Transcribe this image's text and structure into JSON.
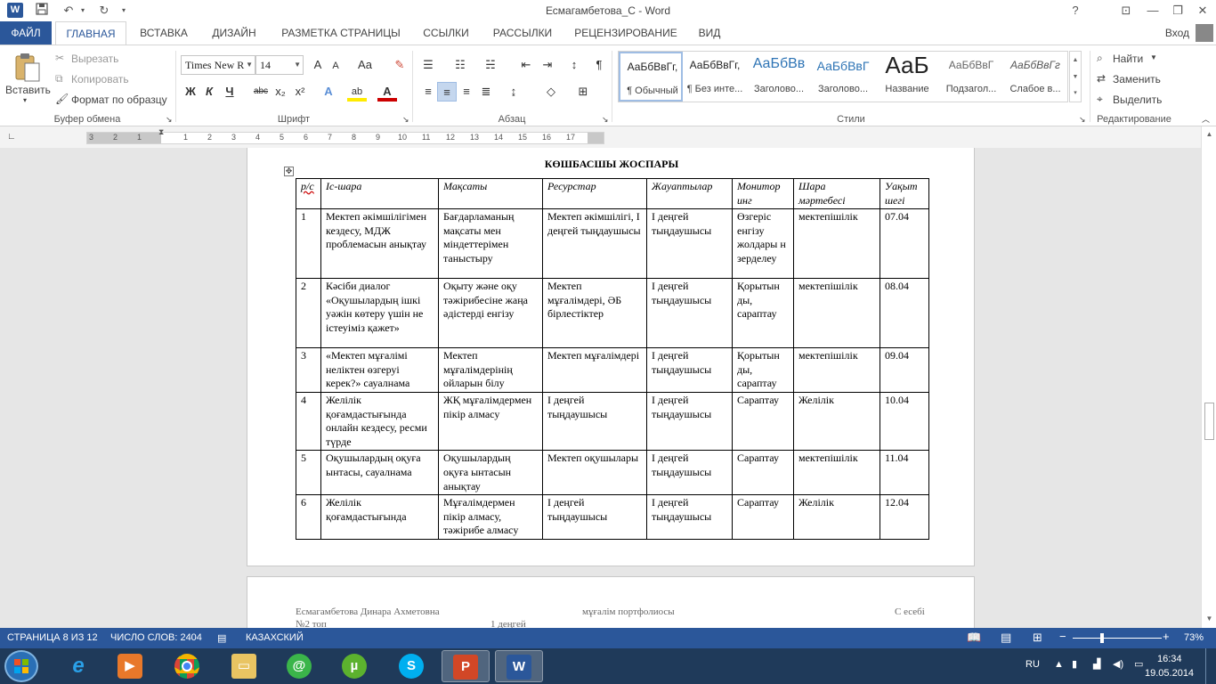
{
  "window": {
    "title": "Есмагамбетова_С - Word",
    "controls": {
      "help": "?",
      "restore_ribbon": "⊡",
      "minimize": "—",
      "maximize": "❐",
      "close": "✕"
    }
  },
  "quick_access": {
    "app_icon": "word-icon",
    "save": "save-icon",
    "undo": "undo-icon",
    "redo": "redo-icon",
    "customize": "dropdown-icon"
  },
  "tabs": [
    {
      "label": "ФАЙЛ"
    },
    {
      "label": "ГЛАВНАЯ"
    },
    {
      "label": "ВСТАВКА"
    },
    {
      "label": "ДИЗАЙН"
    },
    {
      "label": "РАЗМЕТКА СТРАНИЦЫ"
    },
    {
      "label": "ССЫЛКИ"
    },
    {
      "label": "РАССЫЛКИ"
    },
    {
      "label": "РЕЦЕНЗИРОВАНИЕ"
    },
    {
      "label": "ВИД"
    }
  ],
  "signin": "Вход",
  "clipboard": {
    "paste": "Вставить",
    "cut": "Вырезать",
    "copy": "Копировать",
    "format_painter": "Формат по образцу",
    "group": "Буфер обмена"
  },
  "font": {
    "name": "Times New R",
    "size": "14",
    "grow": "A",
    "shrink": "A",
    "case": "Aa",
    "bold": "Ж",
    "italic": "К",
    "underline": "Ч",
    "strike": "abc",
    "sub": "x₂",
    "sup": "x²",
    "effects": "A",
    "highlight": "ab",
    "color": "A",
    "group": "Шрифт"
  },
  "paragraph": {
    "group": "Абзац",
    "pilcrow": "¶"
  },
  "styles": {
    "items": [
      {
        "sample": "АаБбВвГг,",
        "name": "¶ Обычный"
      },
      {
        "sample": "АаБбВвГг,",
        "name": "¶ Без инте..."
      },
      {
        "sample": "АаБбВв",
        "name": "Заголово..."
      },
      {
        "sample": "АаБбВвГ",
        "name": "Заголово..."
      },
      {
        "sample": "АаБ",
        "name": "Название"
      },
      {
        "sample": "АаБбВвГ",
        "name": "Подзагол..."
      },
      {
        "sample": "АаБбВвГг",
        "name": "Слабое в..."
      }
    ],
    "group": "Стили"
  },
  "editing": {
    "find": "Найти",
    "replace": "Заменить",
    "select": "Выделить",
    "group": "Редактирование"
  },
  "ruler": {
    "numbers": [
      "3",
      "2",
      "1",
      "1",
      "2",
      "3",
      "4",
      "5",
      "6",
      "7",
      "8",
      "9",
      "10",
      "11",
      "12",
      "13",
      "14",
      "15",
      "16",
      "17"
    ]
  },
  "document": {
    "heading": "КӨШБАСШЫ ЖОСПАРЫ",
    "table": {
      "headers": [
        "р/с",
        "Іс-шара",
        "Мақсаты",
        "Ресурстар",
        "Жауаптылар",
        "Монитор инг",
        "Шара мәртебесі",
        "Уақыт шегі"
      ],
      "rows": [
        [
          "1",
          "Мектеп әкімшілігімен кездесу, МДЖ проблемасын анықтау",
          "Бағдарламаның мақсаты мен міндеттерімен таныстыру",
          "Мектеп әкімшілігі, І деңгей тыңдаушысы",
          "І деңгей тыңдаушысы",
          "Өзгеріс енгізу жолдары н зерделеу",
          "мектепішілік",
          "07.04"
        ],
        [
          "2",
          "Кәсіби диалог «Оқушылардың ішкі уәжін көтеру үшін не істеуіміз қажет»",
          "Оқыту және оқу тәжірибесіне жаңа әдістерді енгізу",
          "Мектеп мұғалімдері, ӘБ бірлестіктер",
          "І деңгей тыңдаушысы",
          "Қорытын ды, сараптау",
          "мектепішілік",
          "08.04"
        ],
        [
          "3",
          "«Мектеп мұғалімі неліктен өзгеруі керек?» сауалнама",
          "Мектеп мұғалімдерінің ойларын білу",
          "Мектеп мұғалімдері",
          "І деңгей тыңдаушысы",
          "Қорытын ды, сараптау",
          "мектепішілік",
          "09.04"
        ],
        [
          "4",
          "Желілік қоғамдастығында онлайн кездесу, ресми түрде",
          "ЖҚ мұғалімдермен пікір алмасу",
          "І деңгей тыңдаушысы",
          "І деңгей тыңдаушысы",
          "Сараптау",
          "Желілік",
          "10.04"
        ],
        [
          "5",
          "Оқушылардың оқуға ынтасы, сауалнама",
          "Оқушылардың оқуға ынтасын анықтау",
          "Мектеп оқушылары",
          "І деңгей тыңдаушысы",
          "Сараптау",
          "мектепішілік",
          "11.04"
        ],
        [
          "6",
          "Желілік қоғамдастығында",
          "Мұғалімдермен пікір алмасу, тәжірибе алмасу",
          "І деңгей тыңдаушысы",
          "І деңгей тыңдаушысы",
          "Сараптау",
          "Желілік",
          "12.04"
        ]
      ]
    },
    "footer": {
      "author": "Есмагамбетова Динара Ахметовна",
      "portfolio": "мұғалім портфолиосы",
      "report": "С есебі",
      "group": "№2 топ",
      "level": "1 деңгей"
    }
  },
  "status": {
    "page": "СТРАНИЦА 8 ИЗ 12",
    "words": "ЧИСЛО СЛОВ: 2404",
    "language": "КАЗАХСКИЙ",
    "zoom": "73%",
    "zoom_level_percent": 73
  },
  "taskbar": {
    "apps": [
      "internet-explorer",
      "media-player",
      "chrome",
      "file-explorer",
      "mail-agent",
      "utorrent",
      "skype",
      "powerpoint",
      "word"
    ],
    "lang": "RU",
    "time": "16:34",
    "date": "19.05.2014"
  },
  "colors": {
    "accent": "#2b579a",
    "taskbar": "#1f3a5a"
  }
}
